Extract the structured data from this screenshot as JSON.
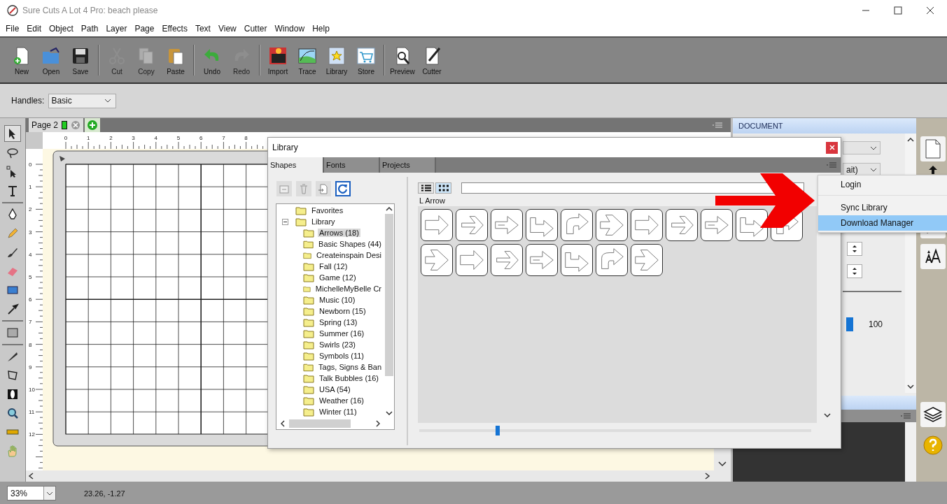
{
  "window": {
    "title": "Sure Cuts A Lot 4 Pro: beach please"
  },
  "menu": [
    "File",
    "Edit",
    "Object",
    "Path",
    "Layer",
    "Page",
    "Effects",
    "Text",
    "View",
    "Cutter",
    "Window",
    "Help"
  ],
  "toolbar": [
    [
      {
        "label": "New",
        "disabled": false
      },
      {
        "label": "Open",
        "disabled": false
      },
      {
        "label": "Save",
        "disabled": false
      }
    ],
    [
      {
        "label": "Cut",
        "disabled": true
      },
      {
        "label": "Copy",
        "disabled": true
      },
      {
        "label": "Paste",
        "disabled": false
      }
    ],
    [
      {
        "label": "Undo",
        "disabled": false
      },
      {
        "label": "Redo",
        "disabled": true
      }
    ],
    [
      {
        "label": "Import",
        "disabled": false
      },
      {
        "label": "Trace",
        "disabled": false
      },
      {
        "label": "Library",
        "disabled": false
      },
      {
        "label": "Store",
        "disabled": false
      }
    ],
    [
      {
        "label": "Preview",
        "disabled": false
      },
      {
        "label": "Cutter",
        "disabled": false
      }
    ]
  ],
  "options_bar": {
    "label": "Handles:",
    "value": "Basic"
  },
  "tools": [
    {
      "selected": true
    },
    {
      "selected": false
    },
    {
      "selected": false
    },
    {
      "selected": false
    },
    {
      "selected": false
    },
    {
      "selected": false
    },
    {
      "selected": false
    },
    {
      "selected": false
    },
    {
      "selected": false
    },
    {
      "selected": false
    },
    {
      "selected": false
    },
    {
      "selected": false
    },
    {
      "selected": false
    },
    {
      "selected": false
    },
    {
      "selected": false
    },
    {
      "selected": false
    },
    {
      "selected": false
    }
  ],
  "page_tabs": [
    {
      "label": "Page 2",
      "selected": true
    }
  ],
  "ruler_h": [
    "0",
    "1",
    "2",
    "3",
    "4",
    "5",
    "6",
    "7",
    "8"
  ],
  "ruler_v": [
    "0",
    "1",
    "2",
    "3",
    "4",
    "5",
    "6",
    "7",
    "8",
    "9",
    "10",
    "11",
    "12"
  ],
  "document_panel": {
    "title": "DOCUMENT",
    "field_value": "ait)",
    "reading": "100"
  },
  "status_bar": {
    "zoom": "33%",
    "coordinates": "23.26, -1.27"
  },
  "library": {
    "title": "Library",
    "tabs": [
      {
        "label": "Shapes",
        "selected": true
      },
      {
        "label": "Fonts",
        "selected": false
      },
      {
        "label": "Projects",
        "selected": false
      }
    ],
    "tree": [
      {
        "label": "Favorites",
        "selected": false
      },
      {
        "label": "Library",
        "selected": false,
        "expanded": true,
        "children": [
          {
            "label": "Arrows (18)",
            "selected": true
          },
          {
            "label": "Basic Shapes (44)",
            "selected": false
          },
          {
            "label": "Createinspain Desi",
            "selected": false
          },
          {
            "label": "Fall (12)",
            "selected": false
          },
          {
            "label": "Game (12)",
            "selected": false
          },
          {
            "label": "MichelleMyBelle Cr",
            "selected": false
          },
          {
            "label": "Music (10)",
            "selected": false
          },
          {
            "label": "Newborn (15)",
            "selected": false
          },
          {
            "label": "Spring (13)",
            "selected": false
          },
          {
            "label": "Summer (16)",
            "selected": false
          },
          {
            "label": "Swirls (23)",
            "selected": false
          },
          {
            "label": "Symbols (11)",
            "selected": false
          },
          {
            "label": "Tags, Signs & Ban",
            "selected": false
          },
          {
            "label": "Talk Bubbles (16)",
            "selected": false
          },
          {
            "label": "USA (54)",
            "selected": false
          },
          {
            "label": "Weather (16)",
            "selected": false
          },
          {
            "label": "Winter (11)",
            "selected": false
          }
        ]
      }
    ],
    "view_modes": [
      {
        "kind": "list",
        "selected": false
      },
      {
        "kind": "grid",
        "selected": true
      }
    ],
    "caption": "L Arrow",
    "zoom_slider": {
      "level": 0.2
    }
  },
  "context_menu": [
    {
      "label": "Login",
      "selected": false
    },
    {
      "label": "Sync Library",
      "selected": false
    },
    {
      "label": "Download Manager",
      "selected": true
    }
  ]
}
